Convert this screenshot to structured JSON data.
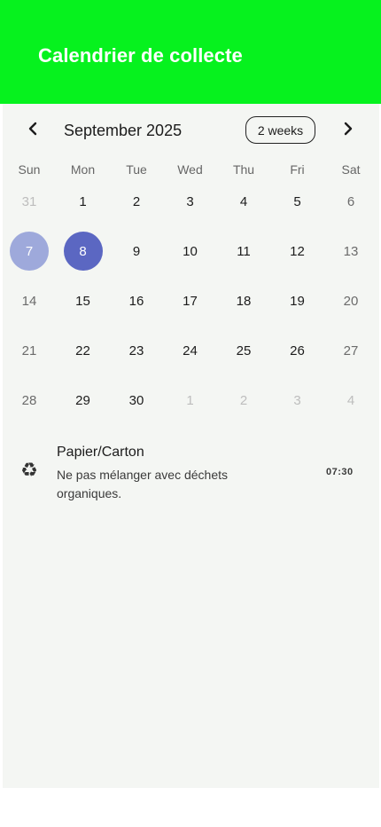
{
  "header": {
    "title": "Calendrier de collecte",
    "background_color": "#06f21e"
  },
  "calendar": {
    "month_label": "September 2025",
    "format_button_label": "2 weeks",
    "prev_icon": "chevron-left-icon",
    "next_icon": "chevron-right-icon",
    "weekdays": [
      "Sun",
      "Mon",
      "Tue",
      "Wed",
      "Thu",
      "Fri",
      "Sat"
    ],
    "weeks": [
      [
        "31",
        "1",
        "2",
        "3",
        "4",
        "5",
        "6"
      ],
      [
        "7",
        "8",
        "9",
        "10",
        "11",
        "12",
        "13"
      ],
      [
        "14",
        "15",
        "16",
        "17",
        "18",
        "19",
        "20"
      ],
      [
        "21",
        "22",
        "23",
        "24",
        "25",
        "26",
        "27"
      ],
      [
        "28",
        "29",
        "30",
        "1",
        "2",
        "3",
        "4"
      ]
    ],
    "today": "7",
    "selected": "8",
    "today_color": "#9ea9db",
    "selected_color": "#5b67c2"
  },
  "events": [
    {
      "icon": "recycle-icon",
      "title": "Papier/Carton",
      "description": "Ne pas mélanger avec déchets organiques.",
      "time": "07:30"
    }
  ]
}
